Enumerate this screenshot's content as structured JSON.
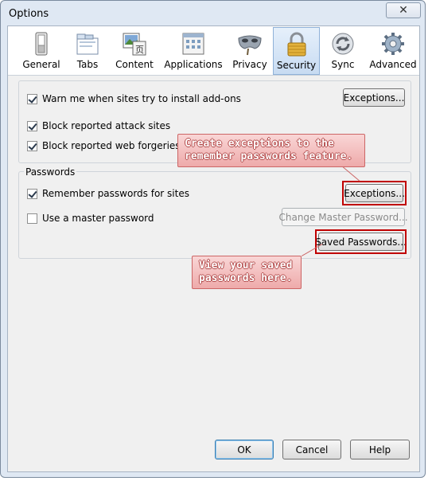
{
  "window": {
    "title": "Options",
    "close_glyph": "✕"
  },
  "toolbar": {
    "selected": "Security",
    "items": [
      {
        "label": "General",
        "icon": "switch-icon"
      },
      {
        "label": "Tabs",
        "icon": "tabs-icon"
      },
      {
        "label": "Content",
        "icon": "content-icon"
      },
      {
        "label": "Applications",
        "icon": "applications-icon"
      },
      {
        "label": "Privacy",
        "icon": "mask-icon"
      },
      {
        "label": "Security",
        "icon": "padlock-icon"
      },
      {
        "label": "Sync",
        "icon": "sync-icon"
      },
      {
        "label": "Advanced",
        "icon": "gear-icon"
      }
    ]
  },
  "security": {
    "warn_addons": {
      "label": "Warn me when sites try to install add-ons",
      "checked": true
    },
    "addons_exceptions": "Exceptions...",
    "block_attack": {
      "label": "Block reported attack sites",
      "checked": true
    },
    "block_forgeries": {
      "label": "Block reported web forgeries",
      "checked": true
    }
  },
  "passwords": {
    "title": "Passwords",
    "remember": {
      "label": "Remember passwords for sites",
      "checked": true
    },
    "exceptions": "Exceptions...",
    "master": {
      "label": "Use a master password",
      "checked": false
    },
    "change_master": "Change Master Password...",
    "saved": "Saved Passwords..."
  },
  "callouts": {
    "exceptions": [
      "Create exceptions to the",
      "remember passwords feature."
    ],
    "saved": [
      "View your saved",
      "passwords here."
    ]
  },
  "footer": {
    "ok": "OK",
    "cancel": "Cancel",
    "help": "Help"
  },
  "colors": {
    "highlight": "#c00000",
    "callout_bg": "#f6c6c6",
    "selected_tab": "#c7dbf2"
  }
}
